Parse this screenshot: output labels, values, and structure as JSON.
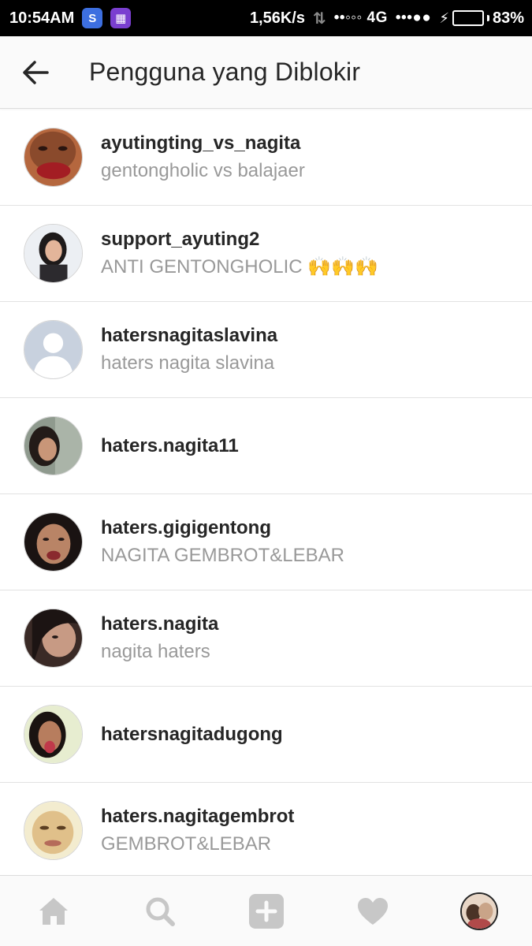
{
  "status_bar": {
    "time": "10:54AM",
    "speed": "1,56K/s",
    "network": "••◦◦◦ 4G",
    "signal": "•••●●",
    "battery": "83%",
    "battery_level": 0.83
  },
  "header": {
    "title": "Pengguna yang Diblokir"
  },
  "blocked_users": [
    {
      "username": "ayutingting_vs_nagita",
      "full_name": "gentongholic vs balajaer"
    },
    {
      "username": "support_ayuting2",
      "full_name": "ANTI GENTONGHOLIC 🙌🙌🙌"
    },
    {
      "username": "hatersnagitaslavina",
      "full_name": "haters nagita slavina"
    },
    {
      "username": "haters.nagita11",
      "full_name": ""
    },
    {
      "username": "haters.gigigentong",
      "full_name": "NAGITA GEMBROT&LEBAR"
    },
    {
      "username": "haters.nagita",
      "full_name": "nagita haters"
    },
    {
      "username": "hatersnagitadugong",
      "full_name": ""
    },
    {
      "username": "haters.nagitagembrot",
      "full_name": "GEMBROT&LEBAR"
    }
  ],
  "bottom_nav": [
    "home-icon",
    "search-icon",
    "add-post-icon",
    "heart-icon",
    "profile-avatar"
  ],
  "colors": {
    "text_primary": "#262626",
    "text_secondary": "#999999",
    "icon_inactive": "#c7c7c7",
    "battery": "#38d35a"
  }
}
